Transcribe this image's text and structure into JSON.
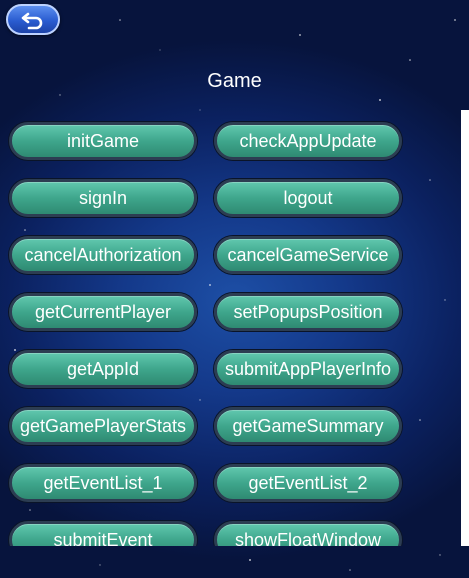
{
  "header": {
    "title": "Game",
    "back_icon": "back-arrow-icon"
  },
  "buttons": [
    "initGame",
    "checkAppUpdate",
    "signIn",
    "logout",
    "cancelAuthorization",
    "cancelGameService",
    "getCurrentPlayer",
    "setPopupsPosition",
    "getAppId",
    "submitAppPlayerInfo",
    "getGamePlayerStats",
    "getGameSummary",
    "getEventList_1",
    "getEventList_2",
    "submitEvent",
    "showFloatWindow"
  ],
  "colors": {
    "accent": "#3fa68c",
    "background": "#14398a",
    "back_button": "#2a5cd0"
  }
}
